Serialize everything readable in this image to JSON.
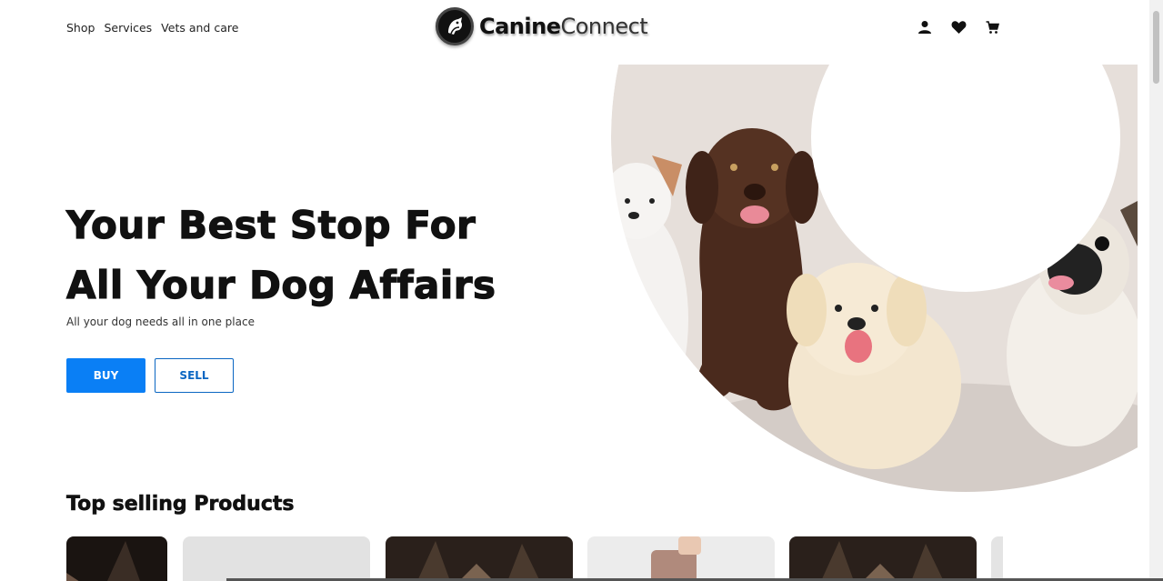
{
  "nav": {
    "items": [
      "Shop",
      "Services",
      "Vets and care"
    ]
  },
  "logo": {
    "bold": "Canine",
    "thin": "Connect"
  },
  "header_icons": [
    "user-icon",
    "heart-icon",
    "cart-icon"
  ],
  "hero": {
    "title_line1": "Your Best Stop For",
    "title_line2": "All Your Dog Affairs",
    "subtitle": "All your dog needs all in one place",
    "buy_label": "BUY",
    "sell_label": "SELL"
  },
  "products_section": {
    "title": "Top selling Products"
  },
  "colors": {
    "primary": "#0a7ff5",
    "text": "#111111",
    "hero_bg": "#e8e1dc"
  }
}
